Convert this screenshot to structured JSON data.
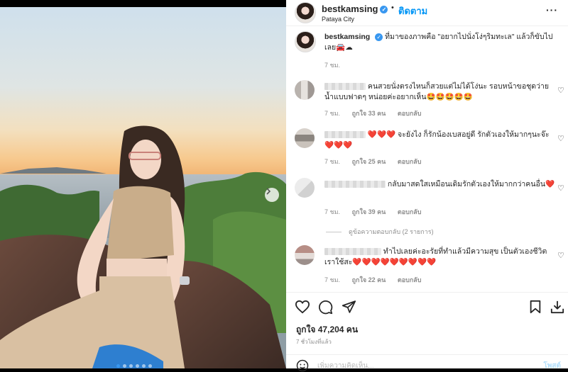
{
  "post": {
    "username": "bestkamsing",
    "verified_glyph": "✓",
    "separator": "•",
    "follow_label": "ติดตาม",
    "location": "Pataya City",
    "more_label": "···",
    "caption": "ที่มาของภาพคือ \"อยากไปนั่งโง่ๆริมทะเล\" แล้วก็ขับไปเลย🚘☁",
    "caption_time": "7 ชม.",
    "likes": "ถูกใจ 47,204 คน",
    "posted_ago": "7 ชั่วโมงที่แล้ว",
    "add_comment_placeholder": "เพิ่มความคิดเห็น...",
    "post_button": "โพสต์"
  },
  "comments": [
    {
      "text": "คนสวยนั่งตรงไหนก็สวยแต่ไม่ได้โง่นะ รอบหน้าขอชุดว่ายน้ำแบบฟาดๆ หน่อยค่ะอยากเห็น🤩🤩🤩🤩🤩",
      "time": "7 ชม.",
      "likes": "ถูกใจ 33 คน",
      "reply": "ตอบกลับ"
    },
    {
      "text": "❤️❤️❤️ จะยังไง ก็รักน้องเบสอยู่ดี รักตัวเองให้มากๆนะจ๊ะ ❤️❤️❤️",
      "time": "7 ชม.",
      "likes": "ถูกใจ 25 คน",
      "reply": "ตอบกลับ"
    },
    {
      "text": "กลับมาสดใสเหมือนเดิมรักตัวเองให้มากกว่าคนอื่น❤️",
      "time": "7 ชม.",
      "likes": "ถูกใจ 39 คน",
      "reply": "ตอบกลับ",
      "view_replies": "ดูข้อความตอบกลับ (2 รายการ)"
    },
    {
      "text": "ทำไปเลยค่ะอะรัยที่ทำแล้วมีความสุข เป็นตัวเองชีวิตเราใช้สะ❤️❤️❤️❤️❤️❤️❤️❤️❤️",
      "time": "7 ชม.",
      "likes": "ถูกใจ 22 คน",
      "reply": "ตอบกลับ"
    }
  ],
  "icons": {
    "like": "heart-icon",
    "comment": "comment-icon",
    "share": "send-icon",
    "save": "bookmark-icon",
    "download": "download-icon",
    "emoji": "smiley-icon",
    "carousel_next": "chevron-right-icon"
  },
  "colors": {
    "accent": "#0095f6",
    "verified": "#3897f0",
    "heart": "#ed1c24"
  }
}
